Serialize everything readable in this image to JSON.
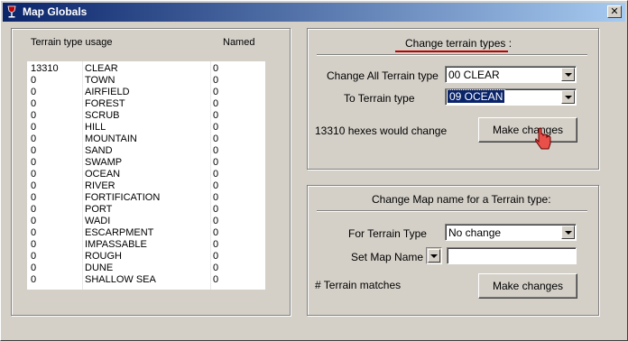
{
  "window": {
    "title": "Map Globals"
  },
  "terrain_panel": {
    "header_usage": "Terrain type usage",
    "header_named": "Named",
    "rows": [
      {
        "count": "13310",
        "name": "CLEAR",
        "named": "0"
      },
      {
        "count": "0",
        "name": "TOWN",
        "named": "0"
      },
      {
        "count": "0",
        "name": "AIRFIELD",
        "named": "0"
      },
      {
        "count": "0",
        "name": "FOREST",
        "named": "0"
      },
      {
        "count": "0",
        "name": "SCRUB",
        "named": "0"
      },
      {
        "count": "0",
        "name": "HILL",
        "named": "0"
      },
      {
        "count": "0",
        "name": "MOUNTAIN",
        "named": "0"
      },
      {
        "count": "0",
        "name": "SAND",
        "named": "0"
      },
      {
        "count": "0",
        "name": "SWAMP",
        "named": "0"
      },
      {
        "count": "0",
        "name": "OCEAN",
        "named": "0"
      },
      {
        "count": "0",
        "name": "RIVER",
        "named": "0"
      },
      {
        "count": "0",
        "name": "FORTIFICATION",
        "named": "0"
      },
      {
        "count": "0",
        "name": "PORT",
        "named": "0"
      },
      {
        "count": "0",
        "name": "WADI",
        "named": "0"
      },
      {
        "count": "0",
        "name": "ESCARPMENT",
        "named": "0"
      },
      {
        "count": "0",
        "name": "IMPASSABLE",
        "named": "0"
      },
      {
        "count": "0",
        "name": "ROUGH",
        "named": "0"
      },
      {
        "count": "0",
        "name": "DUNE",
        "named": "0"
      },
      {
        "count": "0",
        "name": "SHALLOW SEA",
        "named": "0"
      }
    ]
  },
  "change_types": {
    "title": "Change terrain types :",
    "change_all_label": "Change All Terrain type",
    "change_all_value": "00 CLEAR",
    "to_label": "To Terrain type",
    "to_value": "09 OCEAN",
    "status": "13310 hexes would change",
    "button": "Make changes"
  },
  "change_name": {
    "title": "Change Map name for a Terrain type:",
    "for_label": "For Terrain Type",
    "for_value": "No change",
    "set_label": "Set Map Name",
    "map_name_value": "",
    "matches_label": "# Terrain matches",
    "button": "Make changes"
  },
  "colors": {
    "accent_red": "#c00000",
    "selection": "#0a246a",
    "titlebar": "#0a246a"
  },
  "icons": {
    "app": "wine-glass-icon",
    "close": "close-icon",
    "cursor": "hand-pointer-icon"
  }
}
